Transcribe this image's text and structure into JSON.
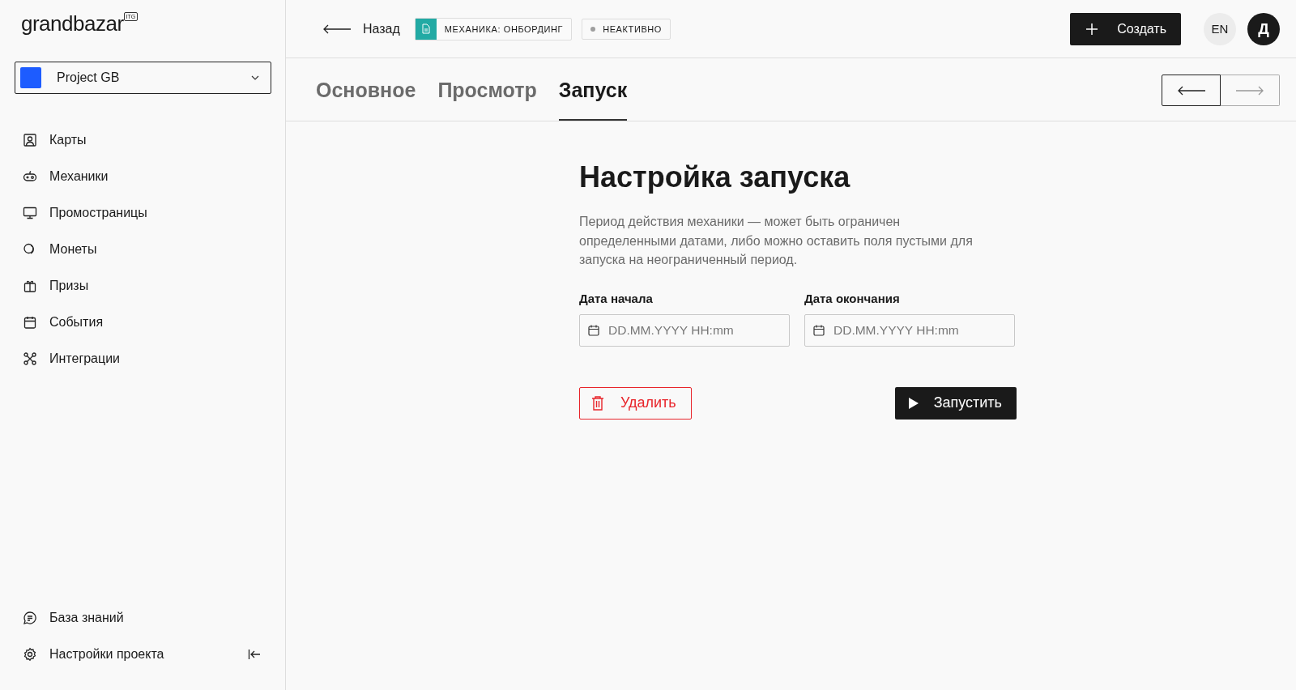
{
  "sidebar": {
    "logo": {
      "name": "grandbazar",
      "badge": "ITG"
    },
    "project": {
      "name": "Project GB"
    },
    "items": [
      {
        "label": "Карты",
        "selected": false
      },
      {
        "label": "Механики",
        "selected": false
      },
      {
        "label": "Промостраницы",
        "selected": false
      },
      {
        "label": "Монеты",
        "selected": false
      },
      {
        "label": "Призы",
        "selected": false
      },
      {
        "label": "События",
        "selected": false
      },
      {
        "label": "Интеграции",
        "selected": false
      }
    ],
    "footer_items": [
      {
        "label": "База знаний"
      },
      {
        "label": "Настройки проекта"
      }
    ]
  },
  "topbar": {
    "back": "Назад",
    "entity_badge": "МЕХАНИКА: ОНБОРДИНГ",
    "status": {
      "label": "НЕАКТИВНО",
      "color": "#9e9e9e"
    },
    "create_button": "Создать",
    "language": "EN",
    "avatar": "Д"
  },
  "tabs": [
    {
      "label": "Основное",
      "selected": false
    },
    {
      "label": "Просмотр",
      "selected": false
    },
    {
      "label": "Запуск",
      "selected": true
    }
  ],
  "pager": {
    "prev_disabled": false,
    "next_disabled": true
  },
  "content": {
    "title": "Настройка запуска",
    "description": "Период действия механики — может быть ограничен определенными датами, либо можно оставить поля пустыми для запуска на неограниченный период.",
    "fields": [
      {
        "label": "Дата начала",
        "placeholder": "DD.MM.YYYY HH:mm"
      },
      {
        "label": "Дата окончания",
        "placeholder": "DD.MM.YYYY HH:mm"
      }
    ],
    "delete_button": "Удалить",
    "start_button": "Запустить"
  }
}
